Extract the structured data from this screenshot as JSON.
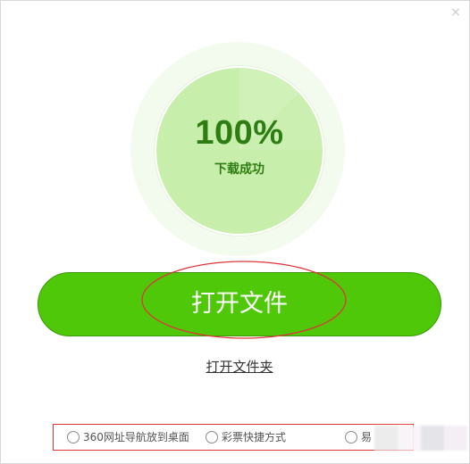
{
  "dialog": {
    "close_glyph": "×"
  },
  "progress": {
    "value": 1.0,
    "percent_label": "100%",
    "status_label": "下载成功"
  },
  "actions": {
    "open_file_label": "打开文件",
    "open_folder_label": "打开文件夹"
  },
  "options": [
    {
      "label": "360网址导航放到桌面",
      "checked": false
    },
    {
      "label": "彩票快捷方式",
      "checked": false
    },
    {
      "label": "易",
      "checked": false
    }
  ],
  "colors": {
    "button_green": "#4ec808",
    "progress_fill": "#c7eeaa",
    "progress_text": "#2e7d12",
    "annotation_red": "#e0343c"
  }
}
